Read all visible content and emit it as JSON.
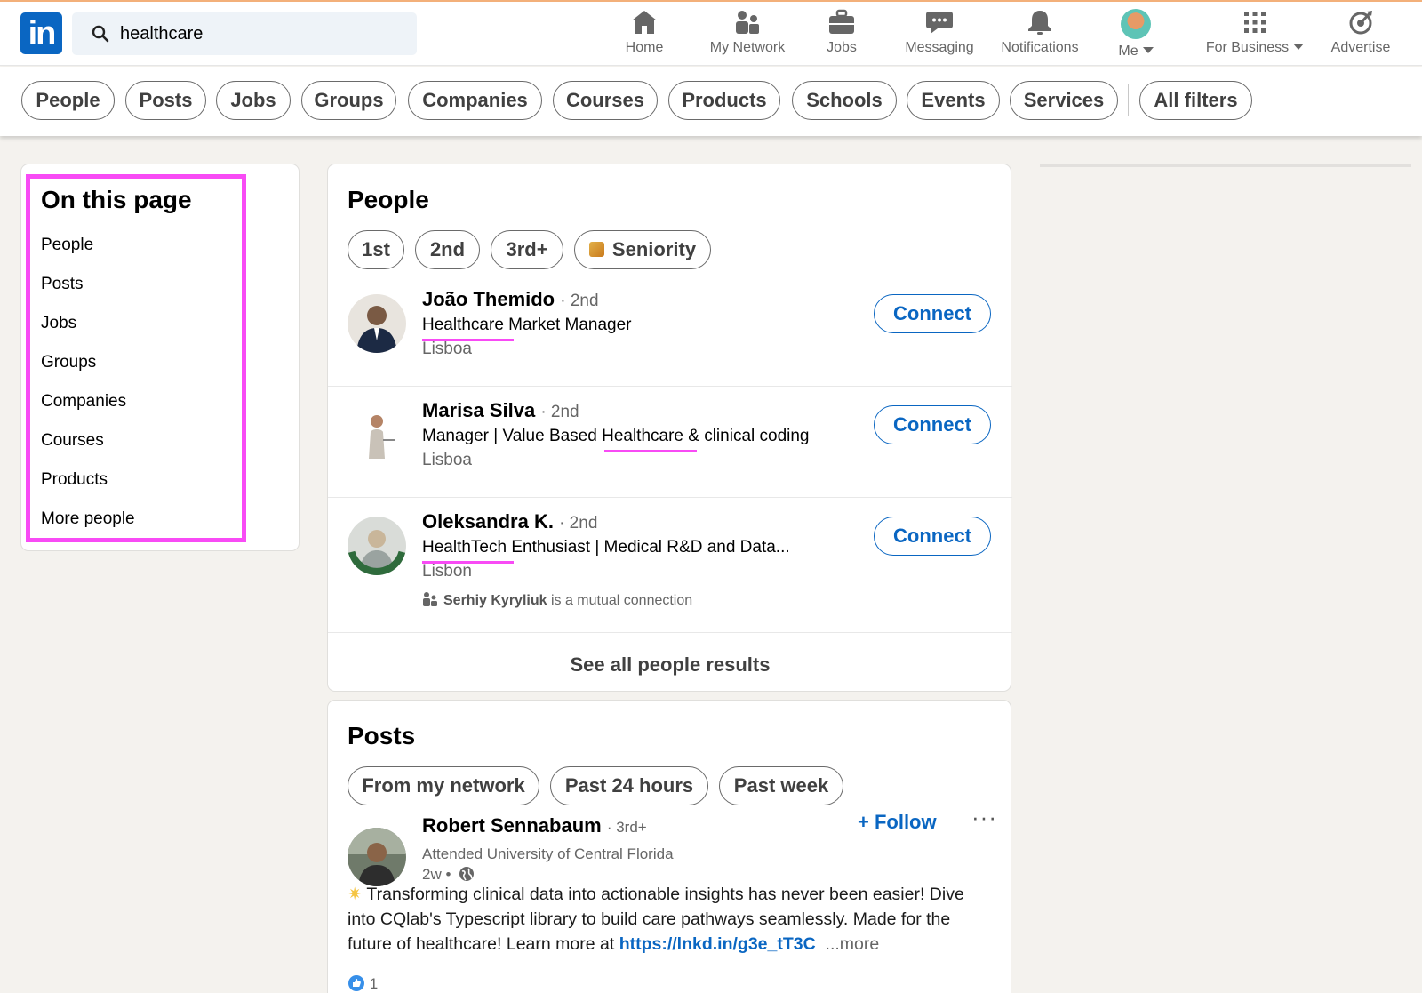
{
  "nav": {
    "logo_text": "in",
    "search_value": "healthcare",
    "items": [
      {
        "label": "Home",
        "icon": "home-icon"
      },
      {
        "label": "My Network",
        "icon": "network-icon"
      },
      {
        "label": "Jobs",
        "icon": "briefcase-icon"
      },
      {
        "label": "Messaging",
        "icon": "chat-icon"
      },
      {
        "label": "Notifications",
        "icon": "bell-icon"
      },
      {
        "label": "Me",
        "icon": "avatar"
      },
      {
        "label": "For Business",
        "icon": "grid-icon"
      },
      {
        "label": "Advertise",
        "icon": "advertise-icon"
      }
    ]
  },
  "filters": [
    "People",
    "Posts",
    "Jobs",
    "Groups",
    "Companies",
    "Courses",
    "Products",
    "Schools",
    "Events",
    "Services",
    "All filters"
  ],
  "on_this_page": {
    "title": "On this page",
    "links": [
      "People",
      "Posts",
      "Jobs",
      "Groups",
      "Companies",
      "Courses",
      "Products",
      "More people"
    ]
  },
  "people_section": {
    "title": "People",
    "filters": [
      "1st",
      "2nd",
      "3rd+",
      "Seniority"
    ],
    "results": [
      {
        "name": "João Themido",
        "degree": "· 2nd",
        "headline": "Healthcare Market Manager",
        "location": "Lisboa",
        "action": "Connect"
      },
      {
        "name": "Marisa Silva",
        "degree": "· 2nd",
        "headline": "Manager | Value Based Healthcare & clinical coding",
        "location": "Lisboa",
        "action": "Connect"
      },
      {
        "name": "Oleksandra K.",
        "degree": "· 2nd",
        "headline": "HealthTech Enthusiast | Medical R&D and Data...",
        "location": "Lisbon",
        "action": "Connect",
        "mutual_name": "Serhiy Kyryliuk",
        "mutual_suffix": "is a mutual connection"
      }
    ],
    "see_all": "See all people results"
  },
  "posts_section": {
    "title": "Posts",
    "filters": [
      "From my network",
      "Past 24 hours",
      "Past week"
    ],
    "post": {
      "author": "Robert Sennabaum",
      "degree": "· 3rd+",
      "subtitle": "Attended University of Central Florida",
      "time": "2w •",
      "follow": "+ Follow",
      "menu": "···",
      "text_1": "Transforming clinical data into actionable insights has never been easier! Dive into CQlab's Typescript library to build care pathways seamlessly. Made for the future of healthcare! Learn more at",
      "link": "https://lnkd.in/g3e_tT3C",
      "more": "...more",
      "reactions": "1"
    }
  },
  "colors": {
    "brand": "#0a66c2",
    "annotation_highlight": "#f84bf5",
    "background": "#f4f2ee"
  }
}
